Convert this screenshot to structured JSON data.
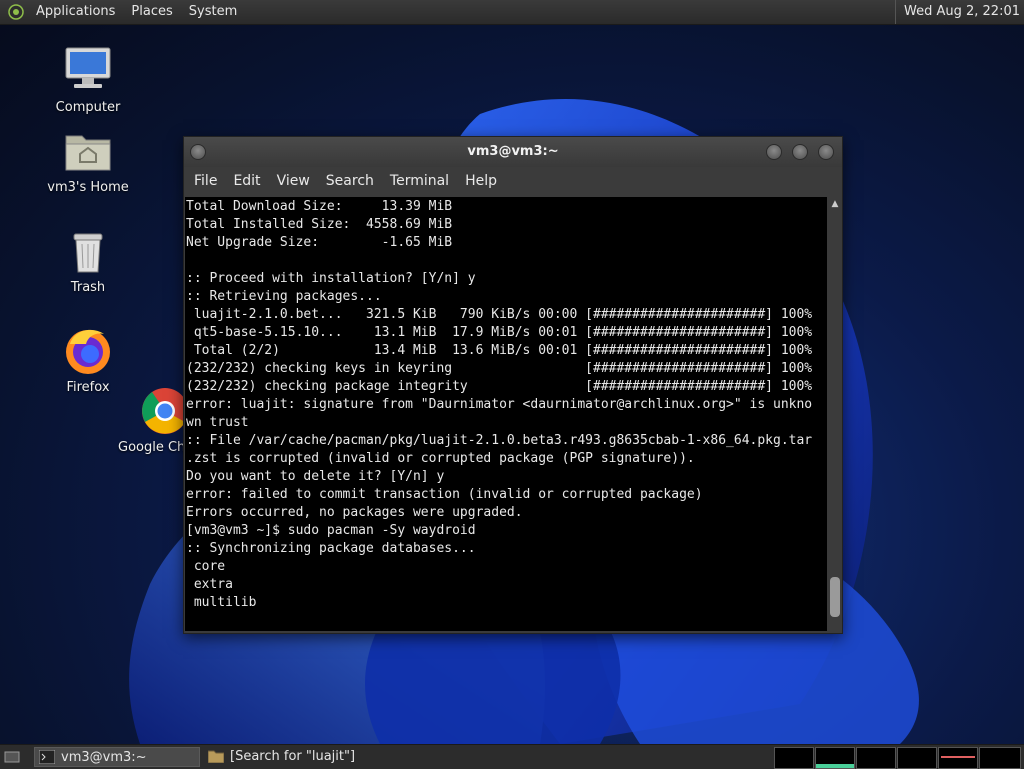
{
  "top_panel": {
    "menus": [
      "Applications",
      "Places",
      "System"
    ],
    "clock": "Wed Aug  2, 22:01"
  },
  "desktop_icons": [
    {
      "label": "Computer",
      "icon": "computer-icon"
    },
    {
      "label": "vm3's Home",
      "icon": "home-folder-icon"
    },
    {
      "label": "Trash",
      "icon": "trash-icon"
    },
    {
      "label": "Firefox",
      "icon": "firefox-icon"
    },
    {
      "label": "Google Ch",
      "icon": "chrome-icon"
    }
  ],
  "terminal": {
    "title": "vm3@vm3:~",
    "menu": [
      "File",
      "Edit",
      "View",
      "Search",
      "Terminal",
      "Help"
    ],
    "lines": [
      "Total Download Size:     13.39 MiB",
      "Total Installed Size:  4558.69 MiB",
      "Net Upgrade Size:        -1.65 MiB",
      "",
      ":: Proceed with installation? [Y/n] y",
      ":: Retrieving packages...",
      " luajit-2.1.0.bet...   321.5 KiB   790 KiB/s 00:00 [######################] 100%",
      " qt5-base-5.15.10...    13.1 MiB  17.9 MiB/s 00:01 [######################] 100%",
      " Total (2/2)            13.4 MiB  13.6 MiB/s 00:01 [######################] 100%",
      "(232/232) checking keys in keyring                 [######################] 100%",
      "(232/232) checking package integrity               [######################] 100%",
      "error: luajit: signature from \"Daurnimator <daurnimator@archlinux.org>\" is unkno",
      "wn trust",
      ":: File /var/cache/pacman/pkg/luajit-2.1.0.beta3.r493.g8635cbab-1-x86_64.pkg.tar",
      ".zst is corrupted (invalid or corrupted package (PGP signature)).",
      "Do you want to delete it? [Y/n] y",
      "error: failed to commit transaction (invalid or corrupted package)",
      "Errors occurred, no packages were upgraded.",
      "[vm3@vm3 ~]$ sudo pacman -Sy waydroid",
      ":: Synchronizing package databases...",
      " core",
      " extra",
      " multilib"
    ]
  },
  "taskbar": {
    "tasks": [
      {
        "label": "vm3@vm3:~",
        "icon": "terminal-icon",
        "active": true
      },
      {
        "label": "[Search for \"luajit\"]",
        "icon": "folder-icon",
        "active": false
      }
    ]
  }
}
